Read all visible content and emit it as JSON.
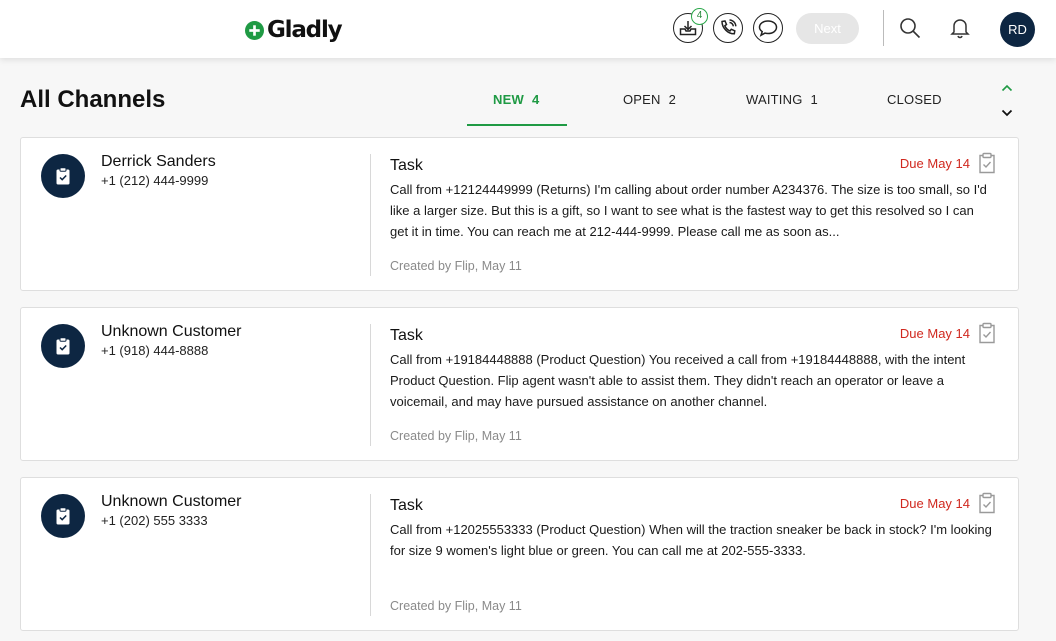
{
  "brand": {
    "name": "Gladly",
    "accent": "#1f9a44",
    "navy": "#0d2642",
    "due_color": "#d0281f"
  },
  "topbar": {
    "inbox_badge": "4",
    "next_label": "Next",
    "avatar_initials": "RD",
    "icons": [
      "inbox-icon",
      "phone-icon",
      "chat-icon",
      "search-icon",
      "bell-icon"
    ]
  },
  "page": {
    "title": "All Channels"
  },
  "tabs": [
    {
      "label": "NEW",
      "count": "4",
      "active": true
    },
    {
      "label": "OPEN",
      "count": "2",
      "active": false
    },
    {
      "label": "WAITING",
      "count": "1",
      "active": false
    },
    {
      "label": "CLOSED",
      "count": "",
      "active": false
    }
  ],
  "cards": [
    {
      "name": "Derrick Sanders",
      "phone": "+1 (212) 444-9999",
      "type": "Task",
      "due": "Due May 14",
      "body": "Call from +12124449999 (Returns) I'm calling about order number A234376. The size is too small, so I'd like a larger size. But this is a gift, so I want to see what is the fastest way to get this resolved so I can get it in time. You can reach me at 212-444-9999. Please call me as soon as...",
      "created": "Created by Flip, May 11"
    },
    {
      "name": "Unknown Customer",
      "phone": "+1 (918) 444-8888",
      "type": "Task",
      "due": "Due May 14",
      "body": "Call from +19184448888 (Product Question) You received a call from +19184448888, with the intent Product Question. Flip agent wasn't able to assist them. They didn't reach an operator or leave a voicemail, and may have pursued assistance on another channel.",
      "created": "Created by Flip, May 11"
    },
    {
      "name": "Unknown Customer",
      "phone": "+1 (202) 555 3333",
      "type": "Task",
      "due": "Due May 14",
      "body": "Call from +12025553333 (Product Question) When will the traction sneaker be back in stock? I'm looking for size 9 women's light blue or green. You can call me at 202-555-3333.",
      "created": "Created by Flip, May 11"
    }
  ]
}
